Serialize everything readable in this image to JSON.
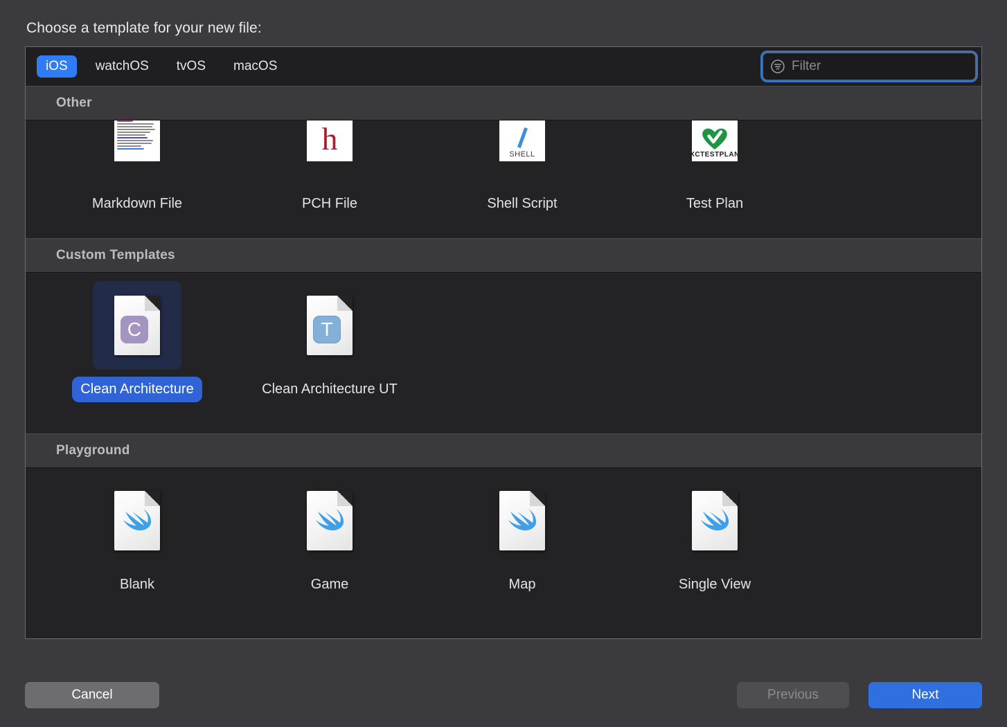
{
  "dialog": {
    "title": "Choose a template for your new file:"
  },
  "toolbar": {
    "platform_tabs": [
      {
        "label": "iOS",
        "selected": true
      },
      {
        "label": "watchOS",
        "selected": false
      },
      {
        "label": "tvOS",
        "selected": false
      },
      {
        "label": "macOS",
        "selected": false
      }
    ],
    "filter": {
      "placeholder": "Filter",
      "value": "",
      "icon": "filter-circle-icon",
      "focused": true,
      "focus_ring_color": "#3c82dc"
    }
  },
  "sections": [
    {
      "header": "Other",
      "items": [
        {
          "label": "Markdown File",
          "icon": "markdown-file-icon",
          "selected": false
        },
        {
          "label": "PCH File",
          "icon": "pch-file-icon",
          "selected": false
        },
        {
          "label": "Shell Script",
          "icon": "shell-script-icon",
          "selected": false
        },
        {
          "label": "Test Plan",
          "icon": "test-plan-icon",
          "selected": false
        }
      ]
    },
    {
      "header": "Custom Templates",
      "items": [
        {
          "label": "Clean Architecture",
          "icon": "clean-architecture-icon",
          "selected": true
        },
        {
          "label": "Clean Architecture UT",
          "icon": "clean-architecture-ut-icon",
          "selected": false
        }
      ]
    },
    {
      "header": "Playground",
      "items": [
        {
          "label": "Blank",
          "icon": "swift-playground-icon",
          "selected": false
        },
        {
          "label": "Game",
          "icon": "swift-playground-icon",
          "selected": false
        },
        {
          "label": "Map",
          "icon": "swift-playground-icon",
          "selected": false
        },
        {
          "label": "Single View",
          "icon": "swift-playground-icon",
          "selected": false
        }
      ]
    }
  ],
  "icon_captions": {
    "shell": "SHELL",
    "test_plan": "XCTESTPLAN",
    "pch_letter": "h",
    "clean_badge": "C",
    "clean_ut_badge": "T"
  },
  "footer": {
    "cancel_label": "Cancel",
    "previous_label": "Previous",
    "previous_disabled": true,
    "next_label": "Next"
  },
  "colors": {
    "accent_blue": "#2f7cf6",
    "selection_blue": "#2f63d6",
    "selection_tile": "#222c48",
    "dialog_bg": "#3b3b3f",
    "panel_bg": "#232325",
    "section_header_bg": "#3a3a3c",
    "swift_blue": "#3fa0e8",
    "test_plan_green": "#1f9442",
    "pch_red": "#a81f2d",
    "badge_purple": "#a394c2",
    "badge_blue": "#82b0d8"
  }
}
